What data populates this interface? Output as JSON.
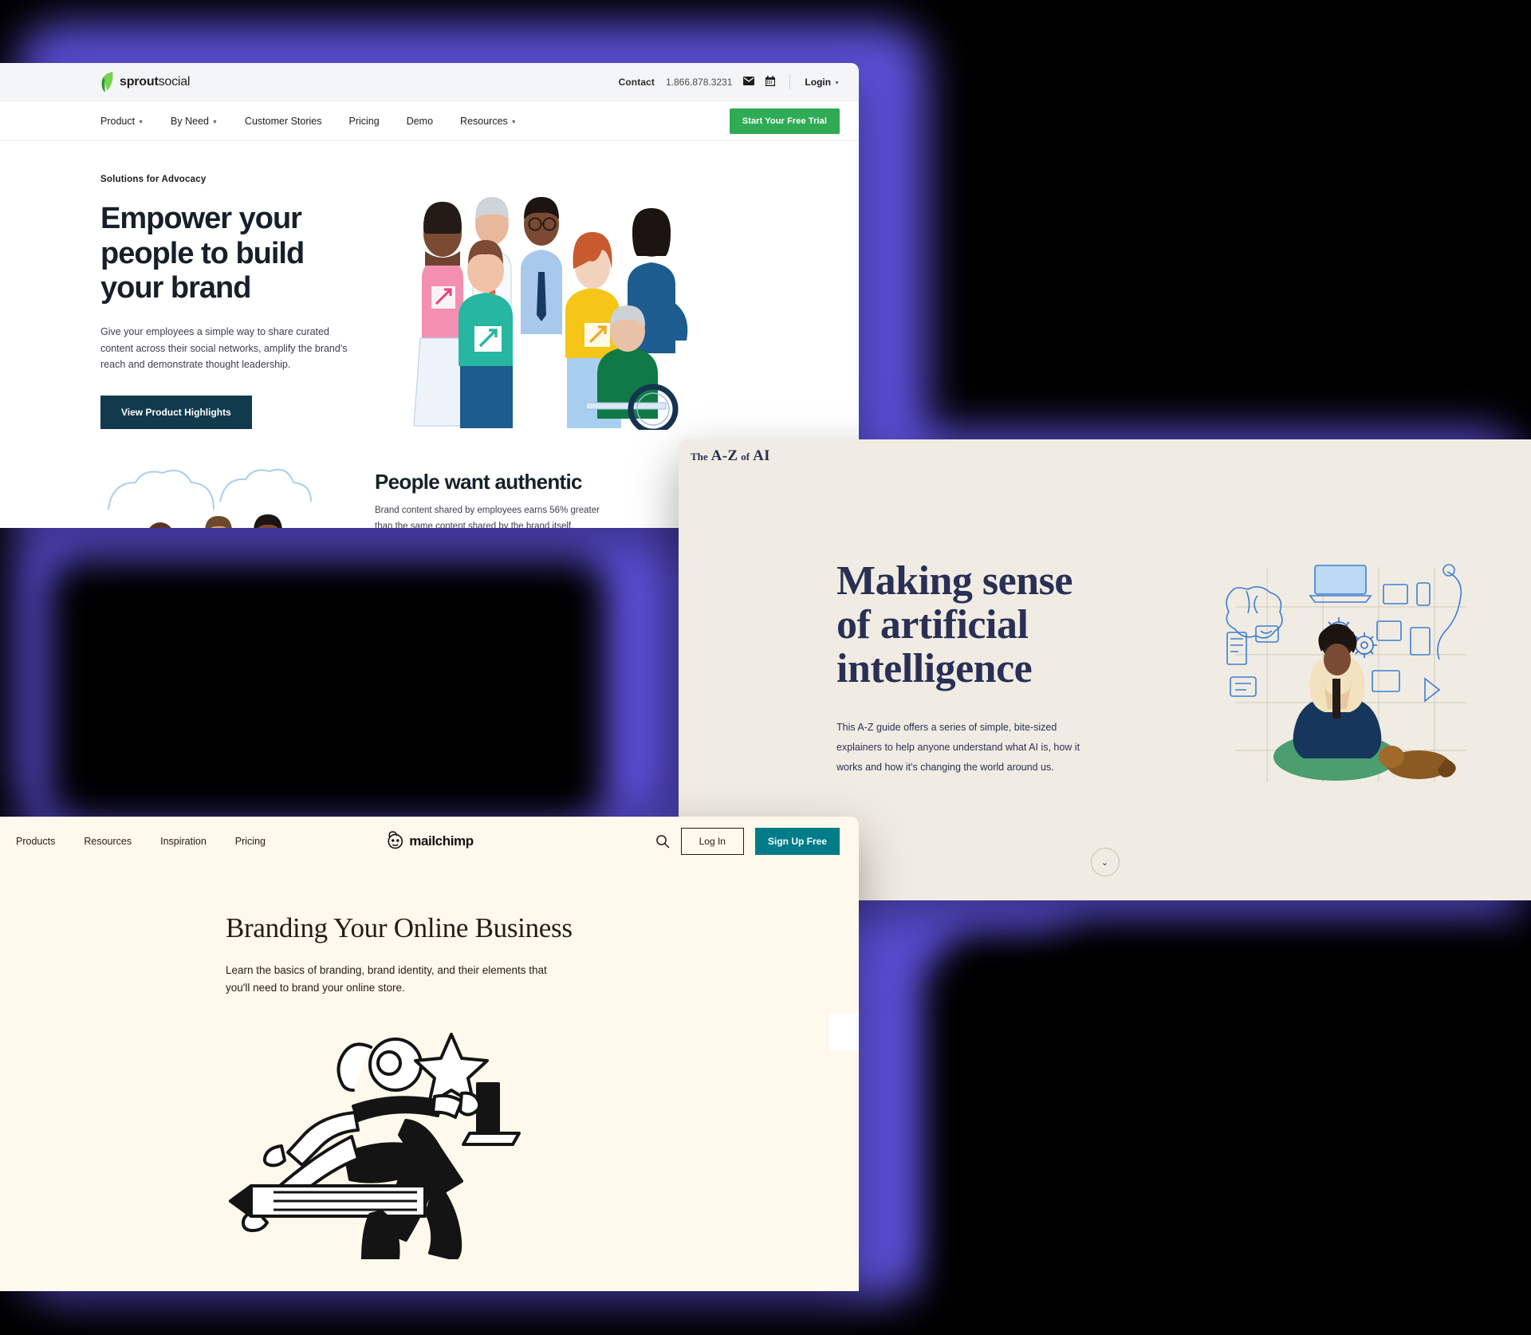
{
  "theme": {
    "glow_purple": "#5b4fd6",
    "backdrop": "#000000",
    "sprout_green": "#2fab55",
    "sprout_dark": "#123a4d",
    "az_bg": "#f1ece3",
    "az_navy": "#2a2f55",
    "mailchimp_bg": "#fff8ec",
    "mailchimp_teal": "#007c89",
    "mailchimp_ink": "#241c15"
  },
  "sprout": {
    "logo": {
      "bold": "sprout",
      "light": "social"
    },
    "topbar": {
      "contact_label": "Contact",
      "phone": "1.866.878.3231",
      "mail_icon": "envelope-icon",
      "calendar_icon": "calendar-icon",
      "login_label": "Login"
    },
    "nav": [
      {
        "label": "Product",
        "has_caret": true
      },
      {
        "label": "By Need",
        "has_caret": true
      },
      {
        "label": "Customer Stories",
        "has_caret": false
      },
      {
        "label": "Pricing",
        "has_caret": false
      },
      {
        "label": "Demo",
        "has_caret": false
      },
      {
        "label": "Resources",
        "has_caret": true
      }
    ],
    "cta_label": "Start Your Free Trial",
    "hero": {
      "eyebrow": "Solutions for Advocacy",
      "heading_line1": "Empower your",
      "heading_line2": "people to build",
      "heading_line3": "your brand",
      "subtitle": "Give your employees a simple way to share curated content across their social networks, amplify the brand's reach and demonstrate thought leadership.",
      "button_label": "View Product Highlights"
    },
    "fold2": {
      "heading": "People want authentic",
      "para_line1": "Brand content shared by employees earns 56% greater",
      "para_line2": "than the same content shared by the brand itself."
    }
  },
  "az": {
    "brand_the": "The",
    "brand_az": "A-Z",
    "brand_of": "of",
    "brand_ai": "AI",
    "heading_line1": "Making sense",
    "heading_line2": "of artificial",
    "heading_line3": "intelligence",
    "paragraph_line1": "This A-Z guide offers a series of simple, bite-sized",
    "paragraph_line2": "explainers to help anyone understand what AI is, how it",
    "paragraph_line3": "works and how it's changing the world around us.",
    "scroll_icon": "chevron-down-icon"
  },
  "mailchimp": {
    "nav": [
      {
        "label": "Products"
      },
      {
        "label": "Resources"
      },
      {
        "label": "Inspiration"
      },
      {
        "label": "Pricing"
      }
    ],
    "logo_text": "mailchimp",
    "logo_icon": "mailchimp-monkey-icon",
    "search_icon": "search-icon",
    "login_label": "Log In",
    "signup_label": "Sign Up Free",
    "heading": "Branding Your Online Business",
    "para_line1": "Learn the basics of branding, brand identity, and their elements that",
    "para_line2": "you'll need to brand your online store."
  }
}
